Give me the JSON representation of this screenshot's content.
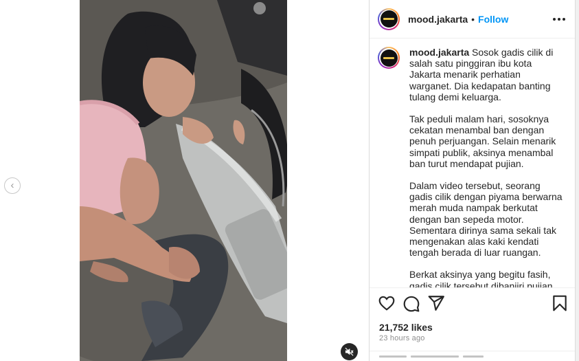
{
  "post": {
    "username": "mood.jakarta",
    "separator": "•",
    "follow_label": "Follow",
    "more_icon": "more-horizontal-icon",
    "caption_paragraphs": [
      "Sosok gadis cilik di salah satu pinggiran ibu kota Jakarta menarik perhatian warganet. Dia kedapatan banting tulang demi keluarga.",
      "Tak peduli malam hari, sosoknya cekatan menambal ban dengan penuh perjuangan. Selain menarik simpati publik, aksinya menambal ban turut mendapat pujian.",
      "Dalam video tersebut, seorang gadis cilik dengan piyama berwarna merah muda nampak berkutat dengan ban sepeda motor. Sementara dirinya sama sekali tak mengenakan alas kaki kendati tengah berada di luar ruangan.",
      "Berkat aksinya yang begitu fasih, gadis cilik tersebut dibanjiri pujian"
    ],
    "likes": "21,752 likes",
    "timestamp": "23 hours ago"
  },
  "media": {
    "prev_arrow": "‹",
    "prev_icon": "chevron-left-icon",
    "mute_icon": "speaker-muted-icon"
  },
  "actions": {
    "like_icon": "heart-icon",
    "comment_icon": "comment-icon",
    "share_icon": "paper-plane-icon",
    "save_icon": "bookmark-icon"
  },
  "colors": {
    "accent": "#0095f6",
    "text": "#262626",
    "muted": "#8e8e8e",
    "border": "#dbdbdb"
  }
}
